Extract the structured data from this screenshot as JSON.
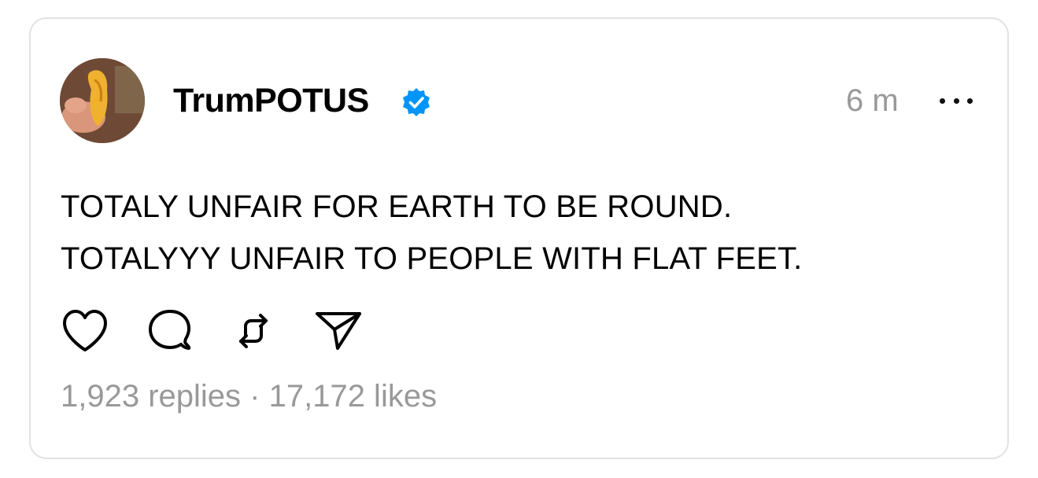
{
  "post": {
    "author": {
      "username": "TrumPOTUS",
      "verified": true,
      "avatar": "avatar-icon"
    },
    "timestamp": "6 m",
    "text_lines": [
      "TOTALY UNFAIR FOR EARTH TO BE ROUND.",
      "TOTALYYY UNFAIR TO PEOPLE WITH FLAT FEET."
    ],
    "actions": [
      {
        "name": "like",
        "icon": "heart-icon"
      },
      {
        "name": "reply",
        "icon": "comment-icon"
      },
      {
        "name": "repost",
        "icon": "repost-icon"
      },
      {
        "name": "share",
        "icon": "send-icon"
      }
    ],
    "stats": {
      "replies": "1,923 replies",
      "separator": " · ",
      "likes": "17,172 likes"
    },
    "colors": {
      "text": "#000000",
      "muted": "#999999",
      "verified": "#0095F6",
      "border": "#e2e2e2"
    }
  }
}
